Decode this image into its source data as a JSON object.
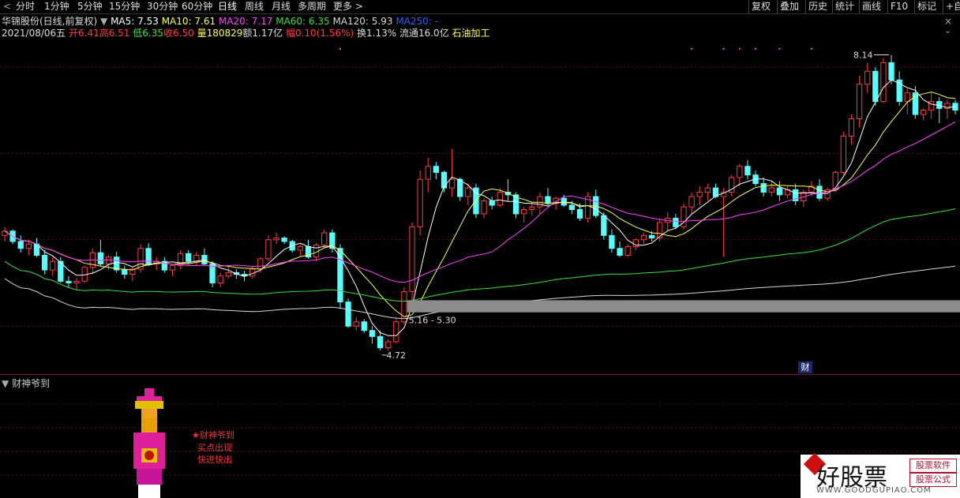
{
  "toolbar": {
    "back_icon": "chevron-left-icon",
    "periods": [
      "分时",
      "1分钟",
      "5分钟",
      "15分钟",
      "30分钟",
      "60分钟",
      "日线",
      "周线",
      "月线",
      "多周期",
      "更多"
    ],
    "active_period": "日线",
    "right_buttons": [
      "复权",
      "叠加",
      "历史",
      "统计",
      "画线",
      "F10",
      "标记"
    ],
    "self_label": "+自"
  },
  "header": {
    "title": "华锦股份(日线,前复权)",
    "ma5": "MA5: 7.53",
    "ma10": "MA10: 7.61",
    "ma20": "MA20: 7.17",
    "ma60": "MA60: 6.35",
    "ma120": "MA120: 5.93",
    "ma250": "MA250: -"
  },
  "info": {
    "date": "2021/08/06五",
    "open": "开6.41",
    "high": "高6.51",
    "low": "低6.35",
    "close": "收6.50",
    "volume": "量180829",
    "amount": "额1.17亿",
    "change": "幅0.10(1.56%)",
    "turnover": "换1.13%",
    "float": "流通16.0亿",
    "industry": "石油加工"
  },
  "annotations": {
    "high_label": "8.14",
    "low_label": "4.72",
    "range_label": "5.16 - 5.30",
    "cai_badge": "财"
  },
  "indicator": {
    "title": "财神爷到",
    "msg_line1": "★财神爷到",
    "msg_line2": "买点出现",
    "msg_line3": "快进快出"
  },
  "watermark": {
    "text": "好股票",
    "tag1": "股票软件",
    "tag2": "股票公式",
    "url": "WWW.GOODGUPIAO.COM"
  },
  "colors": {
    "up": "#ff3b3b",
    "down": "#54ffff",
    "ma5": "#ffffff",
    "ma10": "#ffff4e",
    "ma20": "#ff40ff",
    "ma60": "#3ae03a",
    "ma120": "#d8d8d8",
    "ma250": "#3060ff"
  },
  "chart_data": {
    "type": "candlestick",
    "y_range": [
      4.5,
      8.3
    ],
    "high": 8.14,
    "low": 4.72,
    "price_band": [
      5.16,
      5.3
    ],
    "ohlc": [
      [
        6.05,
        6.15,
        5.98,
        6.1
      ],
      [
        6.1,
        6.12,
        5.95,
        5.98
      ],
      [
        5.98,
        6.05,
        5.85,
        5.9
      ],
      [
        5.9,
        6.0,
        5.82,
        5.95
      ],
      [
        5.95,
        6.02,
        5.8,
        5.82
      ],
      [
        5.82,
        5.88,
        5.6,
        5.65
      ],
      [
        5.65,
        5.8,
        5.58,
        5.75
      ],
      [
        5.75,
        5.8,
        5.5,
        5.52
      ],
      [
        5.52,
        5.58,
        5.45,
        5.5
      ],
      [
        5.5,
        5.56,
        5.42,
        5.52
      ],
      [
        5.52,
        5.7,
        5.5,
        5.68
      ],
      [
        5.68,
        5.9,
        5.6,
        5.85
      ],
      [
        5.85,
        6.0,
        5.7,
        5.72
      ],
      [
        5.72,
        5.82,
        5.65,
        5.8
      ],
      [
        5.8,
        5.86,
        5.62,
        5.65
      ],
      [
        5.65,
        5.7,
        5.55,
        5.6
      ],
      [
        5.6,
        5.68,
        5.52,
        5.66
      ],
      [
        5.66,
        5.95,
        5.62,
        5.9
      ],
      [
        5.9,
        5.96,
        5.7,
        5.72
      ],
      [
        5.72,
        5.8,
        5.65,
        5.75
      ],
      [
        5.75,
        5.8,
        5.62,
        5.65
      ],
      [
        5.65,
        5.72,
        5.58,
        5.7
      ],
      [
        5.7,
        5.88,
        5.66,
        5.84
      ],
      [
        5.84,
        5.88,
        5.72,
        5.75
      ],
      [
        5.75,
        5.86,
        5.7,
        5.82
      ],
      [
        5.82,
        5.9,
        5.7,
        5.72
      ],
      [
        5.72,
        5.75,
        5.45,
        5.5
      ],
      [
        5.5,
        5.62,
        5.45,
        5.58
      ],
      [
        5.58,
        5.7,
        5.55,
        5.62
      ],
      [
        5.62,
        5.66,
        5.55,
        5.6
      ],
      [
        5.6,
        5.64,
        5.52,
        5.58
      ],
      [
        5.58,
        5.7,
        5.55,
        5.66
      ],
      [
        5.66,
        5.8,
        5.62,
        5.78
      ],
      [
        5.78,
        6.05,
        5.75,
        6.0
      ],
      [
        6.0,
        6.08,
        5.95,
        6.02
      ],
      [
        6.02,
        6.04,
        5.95,
        5.98
      ],
      [
        5.98,
        6.0,
        5.85,
        5.88
      ],
      [
        5.88,
        5.95,
        5.8,
        5.92
      ],
      [
        5.92,
        6.0,
        5.78,
        5.8
      ],
      [
        5.8,
        5.96,
        5.75,
        5.94
      ],
      [
        5.94,
        6.12,
        5.9,
        6.08
      ],
      [
        6.08,
        6.12,
        5.85,
        5.9
      ],
      [
        5.9,
        5.95,
        5.2,
        5.28
      ],
      [
        5.28,
        5.32,
        4.98,
        5.0
      ],
      [
        5.0,
        5.1,
        4.95,
        5.05
      ],
      [
        5.05,
        5.08,
        4.92,
        4.95
      ],
      [
        4.95,
        5.0,
        4.8,
        4.88
      ],
      [
        4.88,
        4.95,
        4.72,
        4.75
      ],
      [
        4.75,
        4.85,
        4.72,
        4.82
      ],
      [
        4.82,
        5.1,
        4.8,
        5.05
      ],
      [
        5.05,
        5.45,
        5.02,
        5.4
      ],
      [
        5.4,
        6.2,
        5.3,
        6.15
      ],
      [
        6.15,
        6.8,
        6.05,
        6.7
      ],
      [
        6.7,
        6.95,
        6.55,
        6.85
      ],
      [
        6.85,
        6.9,
        6.7,
        6.78
      ],
      [
        6.78,
        6.8,
        6.55,
        6.6
      ],
      [
        6.6,
        7.05,
        6.5,
        6.7
      ],
      [
        6.7,
        6.72,
        6.45,
        6.5
      ],
      [
        6.5,
        6.65,
        6.4,
        6.6
      ],
      [
        6.6,
        6.65,
        6.25,
        6.3
      ],
      [
        6.3,
        6.48,
        6.25,
        6.45
      ],
      [
        6.45,
        6.5,
        6.35,
        6.4
      ],
      [
        6.4,
        6.6,
        6.38,
        6.55
      ],
      [
        6.55,
        6.7,
        6.45,
        6.52
      ],
      [
        6.52,
        6.55,
        6.25,
        6.3
      ],
      [
        6.3,
        6.38,
        6.2,
        6.35
      ],
      [
        6.35,
        6.42,
        6.28,
        6.38
      ],
      [
        6.38,
        6.55,
        6.3,
        6.5
      ],
      [
        6.5,
        6.6,
        6.4,
        6.42
      ],
      [
        6.42,
        6.5,
        6.35,
        6.48
      ],
      [
        6.48,
        6.52,
        6.38,
        6.4
      ],
      [
        6.4,
        6.45,
        6.3,
        6.35
      ],
      [
        6.35,
        6.42,
        6.22,
        6.25
      ],
      [
        6.25,
        6.55,
        6.2,
        6.5
      ],
      [
        6.5,
        6.58,
        6.25,
        6.28
      ],
      [
        6.28,
        6.32,
        6.0,
        6.05
      ],
      [
        6.05,
        6.12,
        5.85,
        5.9
      ],
      [
        5.9,
        5.98,
        5.8,
        5.82
      ],
      [
        5.82,
        5.95,
        5.8,
        5.92
      ],
      [
        5.92,
        6.02,
        5.88,
        6.0
      ],
      [
        6.0,
        6.08,
        5.95,
        6.05
      ],
      [
        6.05,
        6.1,
        5.98,
        6.02
      ],
      [
        6.02,
        6.25,
        5.98,
        6.2
      ],
      [
        6.2,
        6.32,
        6.1,
        6.25
      ],
      [
        6.25,
        6.3,
        6.12,
        6.15
      ],
      [
        6.15,
        6.42,
        6.12,
        6.38
      ],
      [
        6.38,
        6.55,
        6.3,
        6.5
      ],
      [
        6.5,
        6.62,
        6.4,
        6.55
      ],
      [
        6.55,
        6.65,
        6.45,
        6.6
      ],
      [
        6.6,
        6.65,
        6.48,
        6.5
      ],
      [
        6.5,
        6.6,
        5.8,
        6.55
      ],
      [
        6.55,
        6.75,
        6.5,
        6.72
      ],
      [
        6.72,
        6.88,
        6.62,
        6.85
      ],
      [
        6.85,
        6.92,
        6.7,
        6.75
      ],
      [
        6.75,
        6.8,
        6.62,
        6.65
      ],
      [
        6.65,
        6.72,
        6.5,
        6.55
      ],
      [
        6.55,
        6.68,
        6.5,
        6.6
      ],
      [
        6.6,
        6.68,
        6.45,
        6.52
      ],
      [
        6.52,
        6.62,
        6.48,
        6.58
      ],
      [
        6.58,
        6.65,
        6.4,
        6.45
      ],
      [
        6.45,
        6.58,
        6.38,
        6.55
      ],
      [
        6.55,
        6.68,
        6.5,
        6.62
      ],
      [
        6.62,
        6.7,
        6.45,
        6.48
      ],
      [
        6.48,
        6.6,
        6.45,
        6.58
      ],
      [
        6.58,
        6.8,
        6.55,
        6.78
      ],
      [
        6.78,
        7.25,
        6.75,
        7.2
      ],
      [
        7.2,
        7.45,
        7.1,
        7.4
      ],
      [
        7.4,
        7.9,
        7.3,
        7.8
      ],
      [
        7.8,
        8.05,
        7.7,
        7.95
      ],
      [
        7.95,
        8.0,
        7.55,
        7.6
      ],
      [
        7.6,
        8.1,
        7.58,
        8.05
      ],
      [
        8.05,
        8.14,
        7.8,
        7.85
      ],
      [
        7.85,
        7.95,
        7.55,
        7.6
      ],
      [
        7.6,
        7.75,
        7.45,
        7.7
      ],
      [
        7.7,
        7.78,
        7.4,
        7.45
      ],
      [
        7.45,
        7.52,
        7.38,
        7.5
      ],
      [
        7.5,
        7.7,
        7.4,
        7.6
      ],
      [
        7.6,
        7.65,
        7.35,
        7.52
      ],
      [
        7.52,
        7.62,
        7.4,
        7.58
      ],
      [
        7.58,
        7.62,
        7.45,
        7.5
      ]
    ]
  }
}
